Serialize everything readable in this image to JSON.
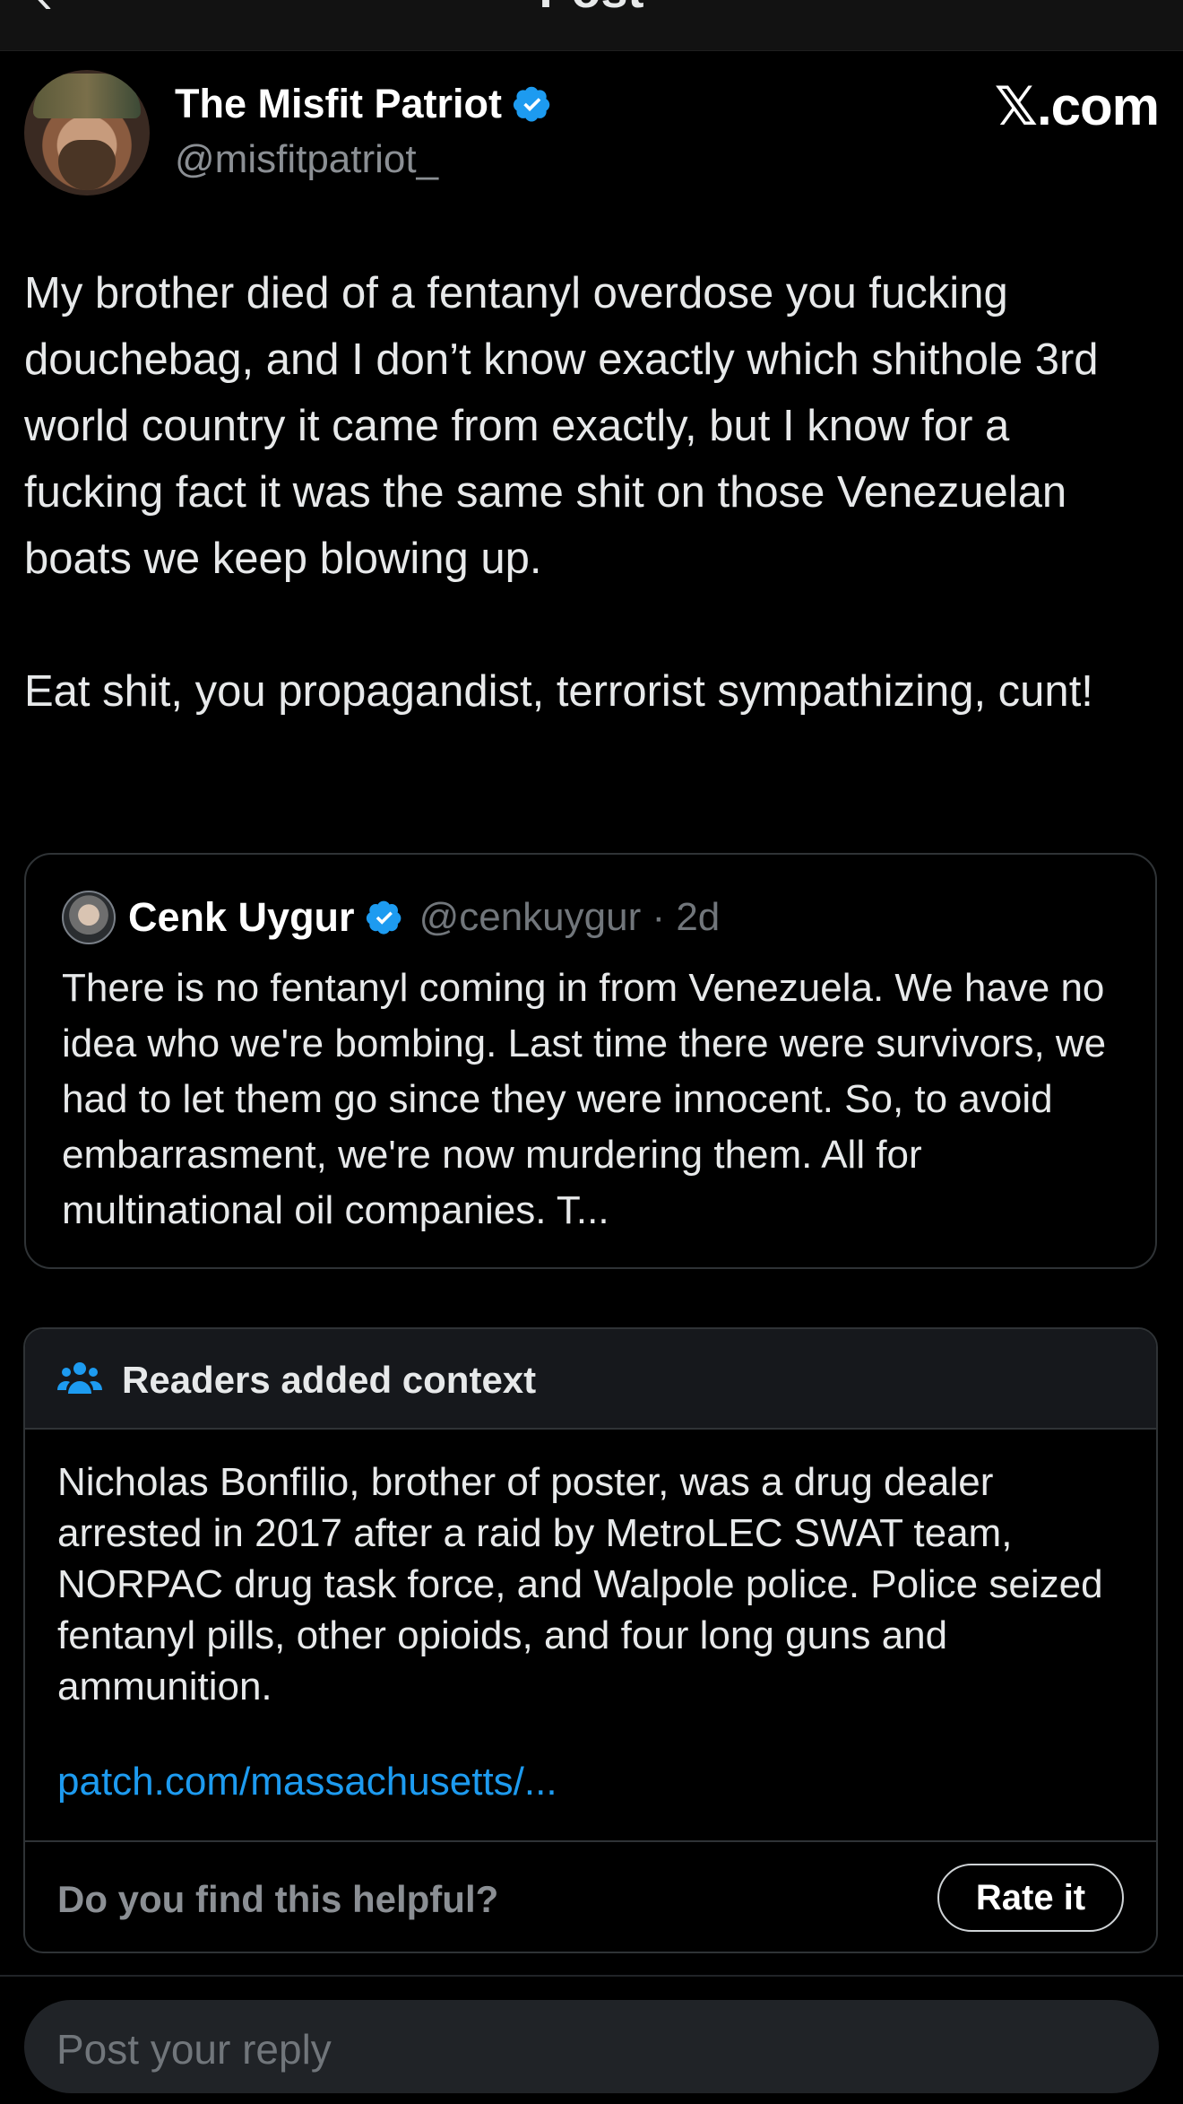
{
  "header": {
    "title": "Post"
  },
  "post": {
    "author_name": "The Misfit Patriot",
    "author_handle": "@misfitpatriot_",
    "brand": "𝕏.com",
    "paragraphs": [
      "My brother died of a fentanyl overdose you fucking douchebag, and I don’t know exactly which shithole 3rd world country it came from exactly, but I know for a fucking fact it was the same shit on those Venezuelan boats we keep blowing up.",
      "Eat shit, you propagandist, terrorist sympathizing, cunt!"
    ]
  },
  "quote": {
    "name": "Cenk Uygur",
    "handle_time": "@cenkuygur · 2d",
    "text": "There is no fentanyl coming in from Venezuela. We have no idea who we're bombing. Last time there were survivors, we had to let them go since they were innocent. So, to avoid embarrasment, we're now murdering them. All for multinational oil companies. T..."
  },
  "note": {
    "title": "Readers added context",
    "body": "Nicholas Bonfilio, brother of poster, was a drug dealer arrested in 2017 after a raid by MetroLEC SWAT team, NORPAC drug task force, and Walpole police. Police seized fentanyl pills, other opioids,  and four long guns and ammunition.",
    "link": "patch.com/massachusetts/...",
    "helpful_question": "Do you find this helpful?",
    "rate_label": "Rate it"
  },
  "reply": {
    "placeholder": "Post your reply"
  },
  "colors": {
    "background": "#000000",
    "accent": "#1d9bf0",
    "verified": "#1d9bf0"
  },
  "icons": {
    "back": "back-arrow-icon",
    "verified": "verified-badge-icon",
    "note": "people-icon"
  }
}
